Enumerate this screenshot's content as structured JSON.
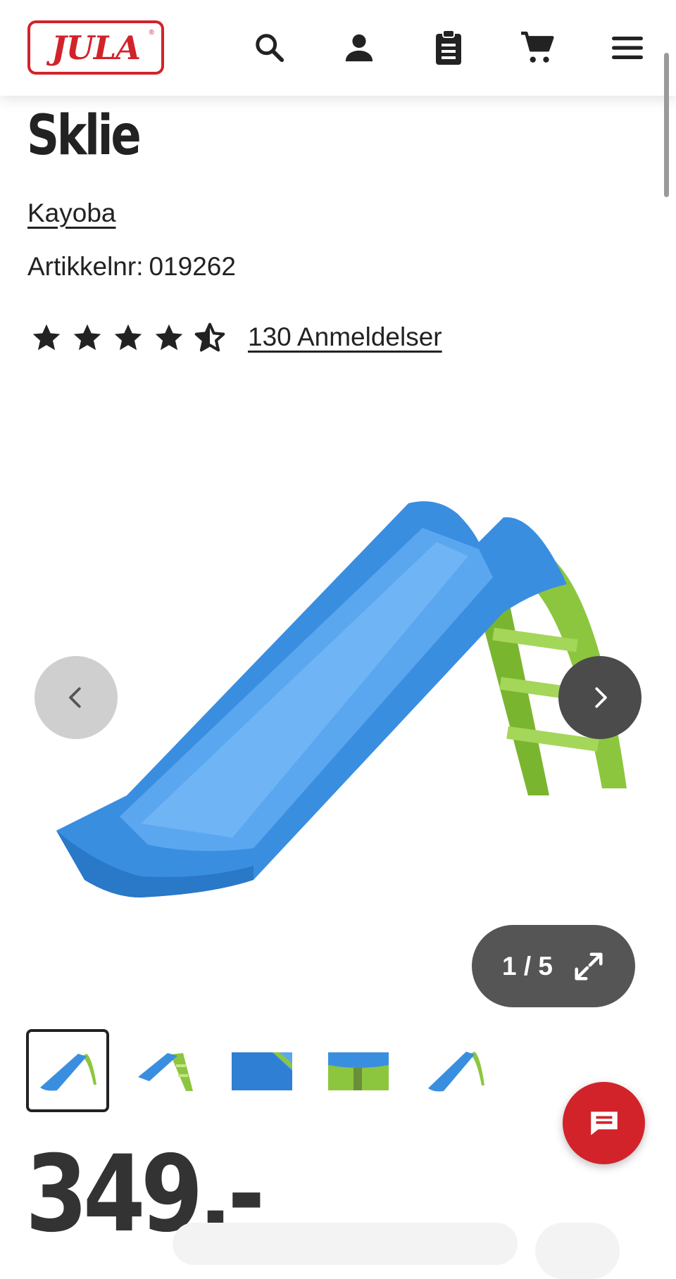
{
  "header": {
    "logo_text": "JULA",
    "logo_mark": "®",
    "icons": [
      "search-icon",
      "account-icon",
      "shopping-list-icon",
      "cart-icon",
      "menu-icon"
    ]
  },
  "product": {
    "title": "Sklie",
    "brand": "Kayoba",
    "sku_label": "Artikkelnr:",
    "sku_value": "019262",
    "rating": 4.5,
    "rating_max": 5,
    "reviews_label": "130 Anmeldelser"
  },
  "gallery": {
    "counter": "1 / 5",
    "current": 1,
    "total": 5,
    "thumbnails": 5
  },
  "price": "349.-",
  "colors": {
    "brand_red": "#d2232a",
    "slide_blue": "#3a8ee0",
    "ladder_green": "#8cc63f"
  }
}
